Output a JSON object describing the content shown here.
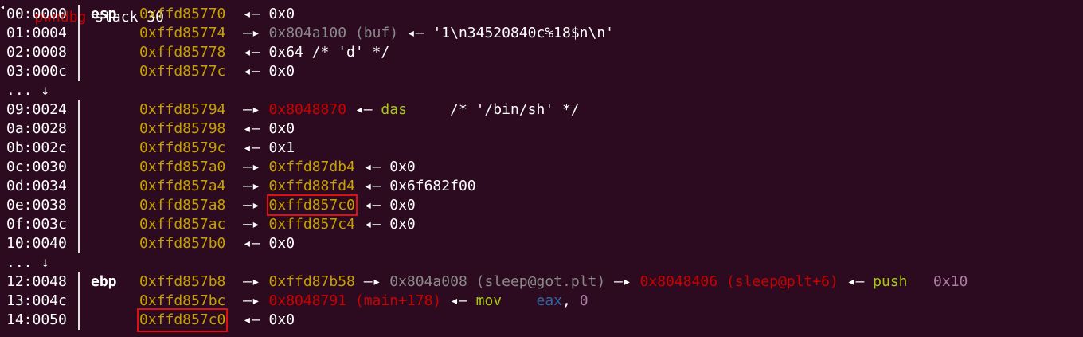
{
  "header": {
    "label": "pwndbg",
    "title": "stack 30"
  },
  "arrows": {
    "points_to": "—▸",
    "value": "◂—",
    "skip": "... ↓"
  },
  "rows": [
    {
      "idx": "00:0000",
      "reg": "esp",
      "addr": "0xffd85770",
      "parts": [
        {
          "t": "◂— ",
          "c": "white"
        },
        {
          "t": "0x0",
          "c": "white"
        }
      ]
    },
    {
      "idx": "01:0004",
      "reg": "",
      "addr": "0xffd85774",
      "parts": [
        {
          "t": "—▸ ",
          "c": "white"
        },
        {
          "t": "0x804a100 (buf)",
          "c": "gray"
        },
        {
          "t": " ◂— ",
          "c": "white"
        },
        {
          "t": "'1\\n34520840c%18$n\\n'",
          "c": "white"
        }
      ]
    },
    {
      "idx": "02:0008",
      "reg": "",
      "addr": "0xffd85778",
      "parts": [
        {
          "t": "◂— ",
          "c": "white"
        },
        {
          "t": "0x64 /* 'd' */",
          "c": "white"
        }
      ]
    },
    {
      "idx": "03:000c",
      "reg": "",
      "addr": "0xffd8577c",
      "parts": [
        {
          "t": "◂— ",
          "c": "white"
        },
        {
          "t": "0x0",
          "c": "white"
        }
      ]
    },
    {
      "skip": true
    },
    {
      "idx": "09:0024",
      "reg": "",
      "addr": "0xffd85794",
      "parts": [
        {
          "t": "—▸ ",
          "c": "white"
        },
        {
          "t": "0x8048870",
          "c": "red"
        },
        {
          "t": " ◂— ",
          "c": "white"
        },
        {
          "t": "das",
          "c": "green"
        },
        {
          "t": "     /* '/bin/sh' */",
          "c": "white"
        }
      ]
    },
    {
      "idx": "0a:0028",
      "reg": "",
      "addr": "0xffd85798",
      "parts": [
        {
          "t": "◂— ",
          "c": "white"
        },
        {
          "t": "0x0",
          "c": "white"
        }
      ]
    },
    {
      "idx": "0b:002c",
      "reg": "",
      "addr": "0xffd8579c",
      "parts": [
        {
          "t": "◂— ",
          "c": "white"
        },
        {
          "t": "0x1",
          "c": "white"
        }
      ]
    },
    {
      "idx": "0c:0030",
      "reg": "",
      "addr": "0xffd857a0",
      "parts": [
        {
          "t": "—▸ ",
          "c": "white"
        },
        {
          "t": "0xffd87db4",
          "c": "yellow"
        },
        {
          "t": " ◂— ",
          "c": "white"
        },
        {
          "t": "0x0",
          "c": "white"
        }
      ]
    },
    {
      "idx": "0d:0034",
      "reg": "",
      "addr": "0xffd857a4",
      "parts": [
        {
          "t": "—▸ ",
          "c": "white"
        },
        {
          "t": "0xffd88fd4",
          "c": "yellow"
        },
        {
          "t": " ◂— ",
          "c": "white"
        },
        {
          "t": "0x6f682f00",
          "c": "white"
        }
      ]
    },
    {
      "idx": "0e:0038",
      "reg": "",
      "addr": "0xffd857a8",
      "parts": [
        {
          "t": "—▸ ",
          "c": "white"
        },
        {
          "t": "0xffd857c0",
          "c": "yellow",
          "hl": true
        },
        {
          "t": " ◂— ",
          "c": "white"
        },
        {
          "t": "0x0",
          "c": "white"
        }
      ]
    },
    {
      "idx": "0f:003c",
      "reg": "",
      "addr": "0xffd857ac",
      "parts": [
        {
          "t": "—▸ ",
          "c": "white"
        },
        {
          "t": "0xffd857c4",
          "c": "yellow"
        },
        {
          "t": " ◂— ",
          "c": "white"
        },
        {
          "t": "0x0",
          "c": "white"
        }
      ]
    },
    {
      "idx": "10:0040",
      "reg": "",
      "addr": "0xffd857b0",
      "parts": [
        {
          "t": "◂— ",
          "c": "white"
        },
        {
          "t": "0x0",
          "c": "white"
        }
      ]
    },
    {
      "skip": true
    },
    {
      "idx": "12:0048",
      "reg": "ebp",
      "addr": "0xffd857b8",
      "parts": [
        {
          "t": "—▸ ",
          "c": "white"
        },
        {
          "t": "0xffd87b58",
          "c": "yellow"
        },
        {
          "t": " —▸ ",
          "c": "white"
        },
        {
          "t": "0x804a008 (sleep@got.plt)",
          "c": "gray"
        },
        {
          "t": " —▸ ",
          "c": "white"
        },
        {
          "t": "0x8048406 (sleep@plt+6)",
          "c": "red"
        },
        {
          "t": " ◂— ",
          "c": "white"
        },
        {
          "t": "push",
          "c": "green"
        },
        {
          "t": "   ",
          "c": "white"
        },
        {
          "t": "0x10",
          "c": "purple"
        }
      ]
    },
    {
      "idx": "13:004c",
      "reg": "",
      "addr": "0xffd857bc",
      "parts": [
        {
          "t": "—▸ ",
          "c": "white"
        },
        {
          "t": "0x8048791 (main+178)",
          "c": "red"
        },
        {
          "t": " ◂— ",
          "c": "white"
        },
        {
          "t": "mov",
          "c": "green"
        },
        {
          "t": "    ",
          "c": "white"
        },
        {
          "t": "eax",
          "c": "blue"
        },
        {
          "t": ", ",
          "c": "white"
        },
        {
          "t": "0",
          "c": "purple"
        }
      ]
    },
    {
      "idx": "14:0050",
      "reg": "",
      "addr": "0xffd857c0",
      "addr_hl": true,
      "parts": [
        {
          "t": "◂— ",
          "c": "white"
        },
        {
          "t": "0x0",
          "c": "white"
        }
      ]
    }
  ],
  "colors": {
    "background": "#2c0a1f",
    "address": "#c4a000",
    "code_pointer": "#cc0000",
    "data_pointer": "#8a8a8a",
    "instruction": "#a6c916",
    "register": "#3465a4",
    "immediate": "#ad7fa8",
    "highlight_box": "#e01010"
  }
}
